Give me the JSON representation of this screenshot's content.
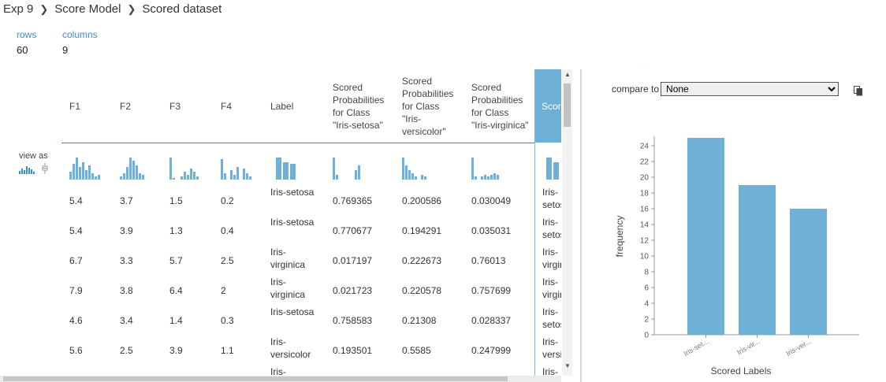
{
  "breadcrumb": {
    "items": [
      "Exp 9",
      "Score Model",
      "Scored dataset"
    ]
  },
  "meta": {
    "rows_label": "rows",
    "rows_value": "60",
    "columns_label": "columns",
    "columns_value": "9"
  },
  "view_as": {
    "label": "view as"
  },
  "columns": [
    {
      "label": "F1"
    },
    {
      "label": "F2"
    },
    {
      "label": "F3"
    },
    {
      "label": "F4"
    },
    {
      "label": "Label"
    },
    {
      "label": "Scored Probabilities for Class \"Iris-setosa\""
    },
    {
      "label": "Scored Probabilities for Class \"Iris-versicolor\""
    },
    {
      "label": "Scored Probabilities for Class \"Iris-virginica\""
    },
    {
      "label": "Scored Labels"
    }
  ],
  "rows": [
    [
      "5.4",
      "3.7",
      "1.5",
      "0.2",
      "Iris-setosa",
      "0.769365",
      "0.200586",
      "0.030049",
      "Iris-setosa"
    ],
    [
      "5.4",
      "3.9",
      "1.3",
      "0.4",
      "Iris-setosa",
      "0.770677",
      "0.194291",
      "0.035031",
      "Iris-setosa"
    ],
    [
      "6.7",
      "3.3",
      "5.7",
      "2.5",
      "Iris-virginica",
      "0.017197",
      "0.222673",
      "0.76013",
      "Iris-virginica"
    ],
    [
      "7.9",
      "3.8",
      "6.4",
      "2",
      "Iris-virginica",
      "0.021723",
      "0.220578",
      "0.757699",
      "Iris-virginica"
    ],
    [
      "4.6",
      "3.4",
      "1.4",
      "0.3",
      "Iris-setosa",
      "0.758583",
      "0.21308",
      "0.028337",
      "Iris-setosa"
    ],
    [
      "5.6",
      "2.5",
      "3.9",
      "1.1",
      "Iris-versicolor",
      "0.193501",
      "0.5585",
      "0.247999",
      "Iris-versicolor"
    ],
    [
      "",
      "",
      "",
      "",
      "Iris-",
      "",
      "",
      "",
      "Iris-"
    ]
  ],
  "compare": {
    "label": "compare to",
    "selected": "None"
  },
  "colors": {
    "accent": "#3a8fc7",
    "bar": "#6fb0d6",
    "header_selected": "#6fb0d6"
  },
  "chart_data": {
    "type": "bar",
    "categories": [
      "Iris-set...",
      "Iris-vir...",
      "Iris-ver..."
    ],
    "values": [
      25,
      19,
      16
    ],
    "xlabel": "Scored Labels",
    "ylabel": "frequency",
    "ylim": [
      0,
      25
    ],
    "yticks": [
      0,
      2,
      4,
      6,
      8,
      10,
      12,
      14,
      16,
      18,
      20,
      22,
      24
    ],
    "grid": false
  }
}
